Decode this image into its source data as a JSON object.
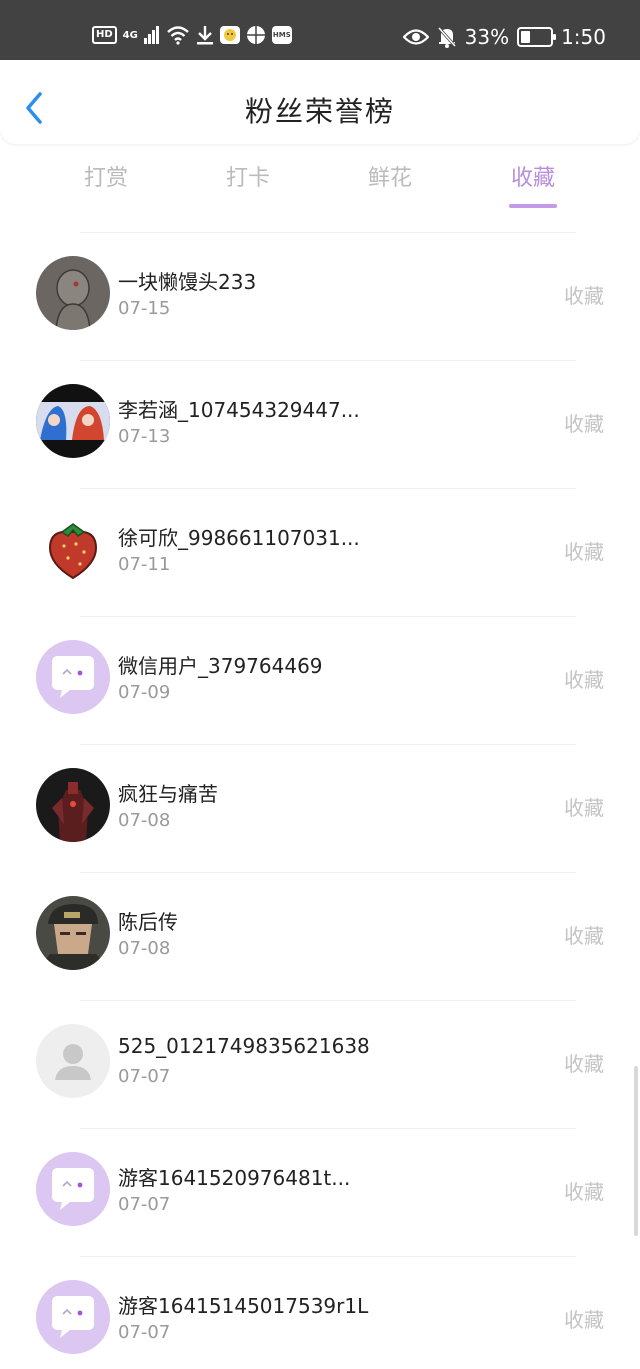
{
  "status_bar": {
    "left_badges": [
      "HD",
      "4G"
    ],
    "hms_label": "HMS",
    "battery": "33%",
    "battery_level": 0.33,
    "time": "1:50"
  },
  "header": {
    "title": "粉丝荣誉榜"
  },
  "tabs": [
    {
      "label": "打赏",
      "active": false
    },
    {
      "label": "打卡",
      "active": false
    },
    {
      "label": "鲜花",
      "active": false
    },
    {
      "label": "收藏",
      "active": true
    }
  ],
  "colors": {
    "accent": "#b88fdc",
    "status_bar": "#424242"
  },
  "fans": [
    {
      "name": "一块懒馒头233",
      "date": "07-15",
      "action": "收藏",
      "avatar": "sketch-figure"
    },
    {
      "name": "李若涵_107454329447...",
      "date": "07-13",
      "action": "收藏",
      "avatar": "anime-girls"
    },
    {
      "name": "徐可欣_998661107031...",
      "date": "07-11",
      "action": "收藏",
      "avatar": "strawberry"
    },
    {
      "name": "微信用户_379764469",
      "date": "07-09",
      "action": "收藏",
      "avatar": "chat-bubble"
    },
    {
      "name": "疯狂与痛苦",
      "date": "07-08",
      "action": "收藏",
      "avatar": "red-mech"
    },
    {
      "name": "陈后传",
      "date": "07-08",
      "action": "收藏",
      "avatar": "capped-man"
    },
    {
      "name": "525_0121749835621638",
      "date": "07-07",
      "action": "收藏",
      "avatar": "default-user"
    },
    {
      "name": "游客1641520976481t...",
      "date": "07-07",
      "action": "收藏",
      "avatar": "chat-bubble"
    },
    {
      "name": "游客16415145017539r1L",
      "date": "07-07",
      "action": "收藏",
      "avatar": "chat-bubble"
    }
  ]
}
